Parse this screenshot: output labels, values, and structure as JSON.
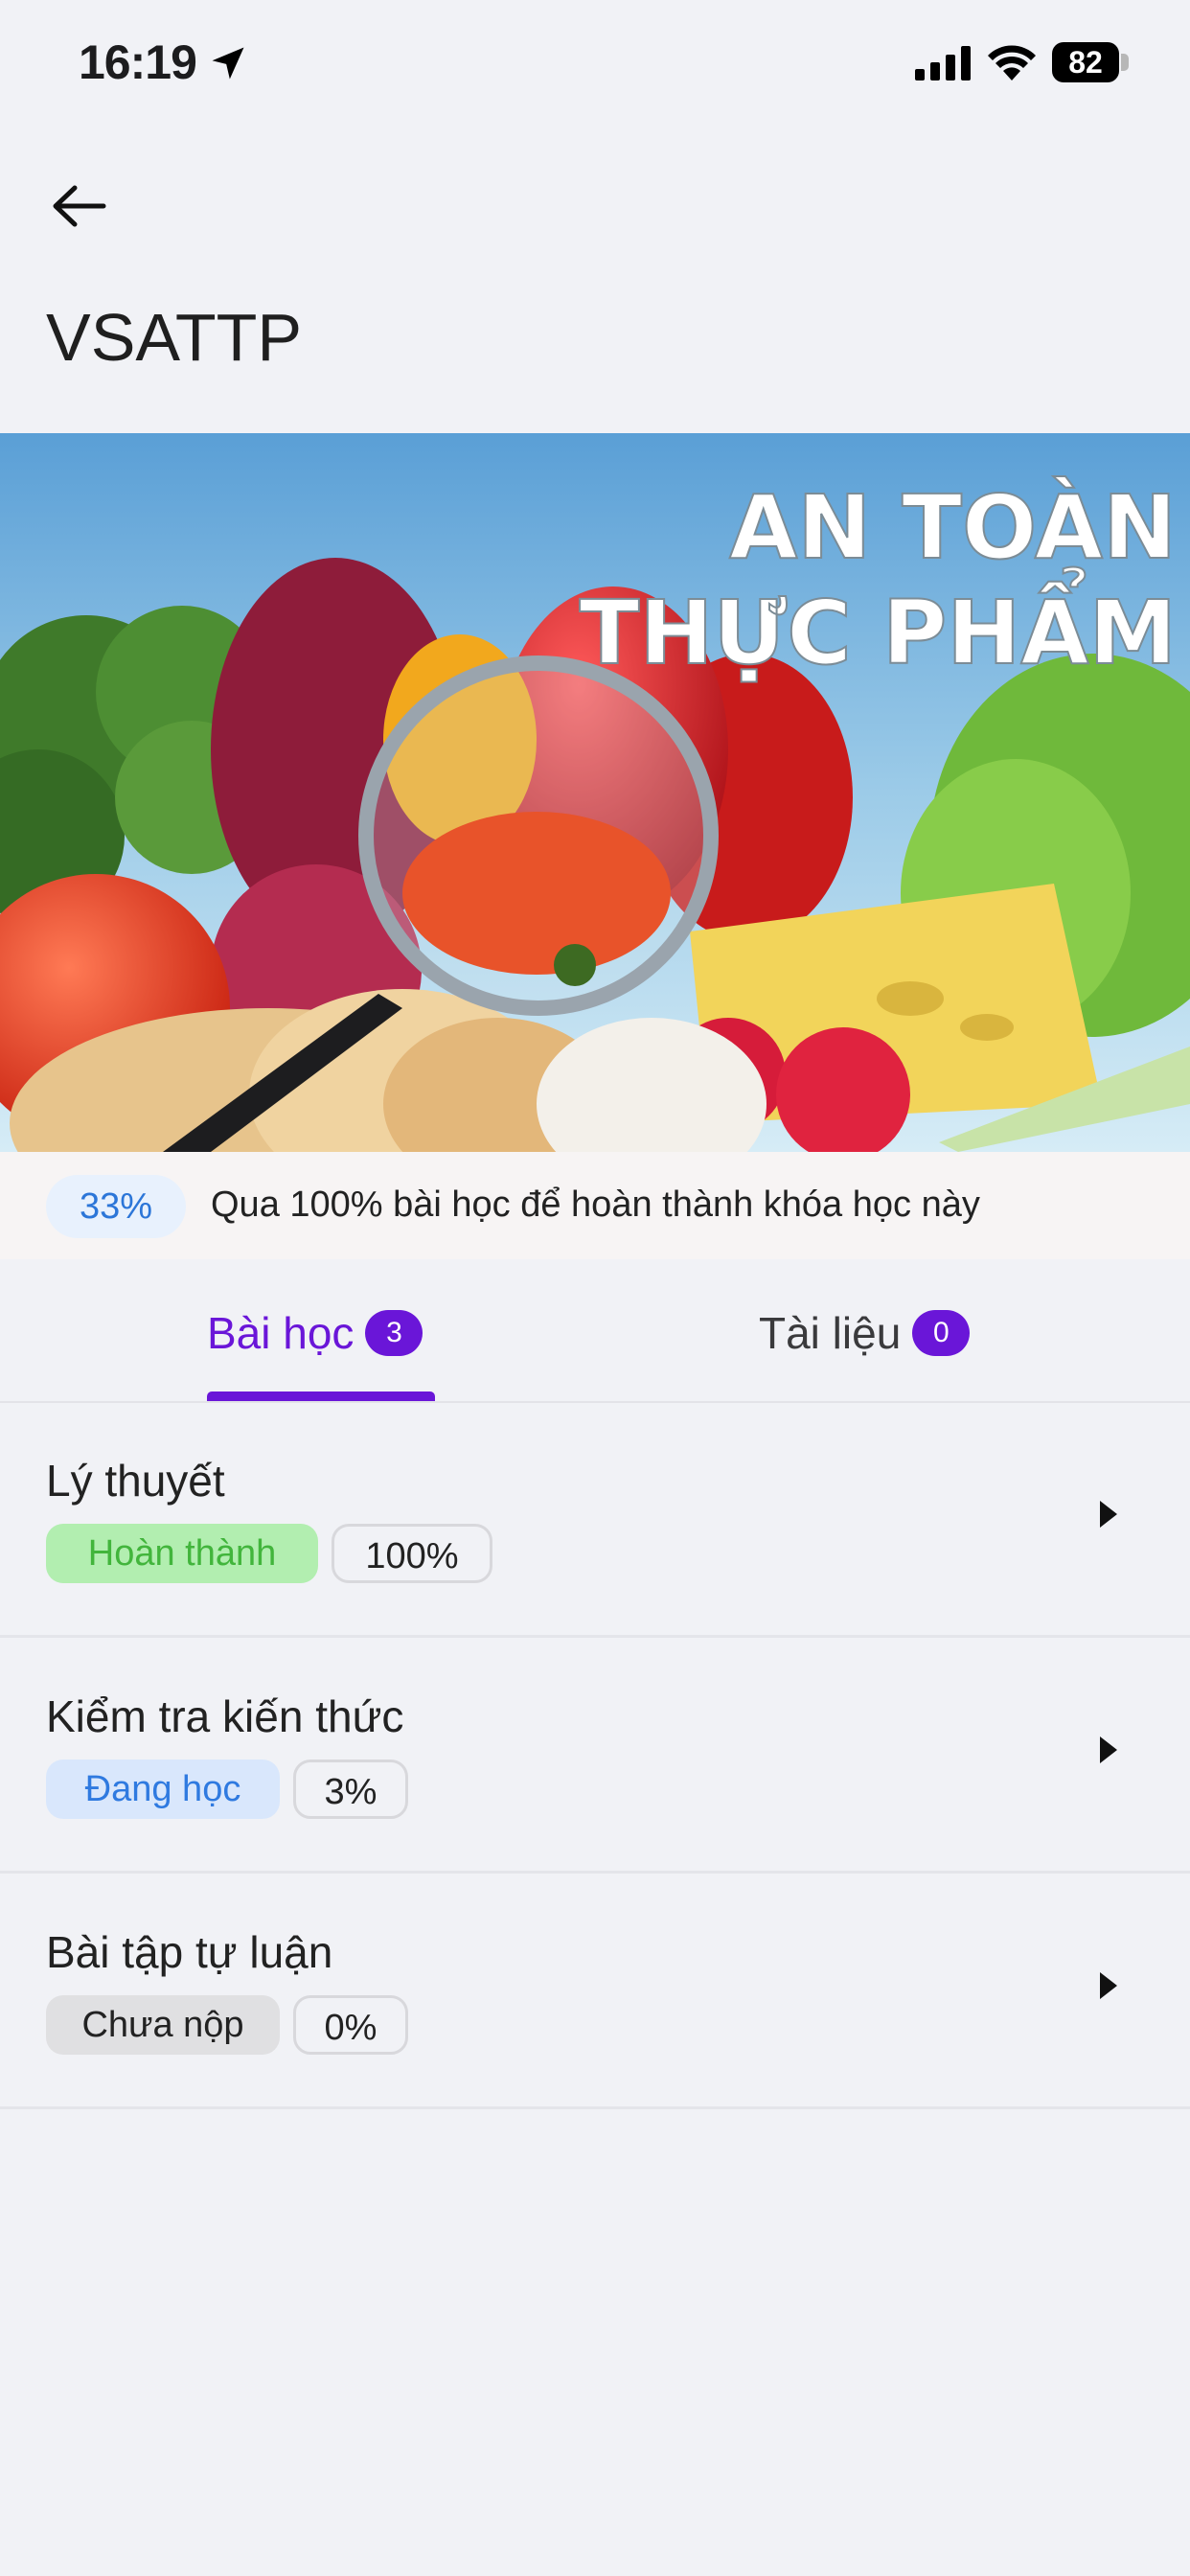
{
  "status_bar": {
    "time": "16:19",
    "battery": "82"
  },
  "header": {
    "title": "VSATTP"
  },
  "banner": {
    "line1": "AN TOÀN",
    "line2": "THỰC PHẨM"
  },
  "progress": {
    "percent_label": "33%",
    "percent": 33,
    "hint": "Qua 100% bài học để hoàn thành khóa học này"
  },
  "tabs": [
    {
      "label": "Bài học",
      "count": "3",
      "active": true
    },
    {
      "label": "Tài liệu",
      "count": "0",
      "active": false
    }
  ],
  "lessons": [
    {
      "title": "Lý thuyết",
      "status": "Hoàn thành",
      "percent": "100%"
    },
    {
      "title": "Kiểm tra kiến thức",
      "status": "Đang học",
      "percent": "3%"
    },
    {
      "title": "Bài tập tự luận",
      "status": "Chưa nộp",
      "percent": "0%"
    }
  ],
  "icons": {
    "back": "arrow-left-icon",
    "location": "location-arrow-icon",
    "signal": "cellular-signal-icon",
    "wifi": "wifi-icon",
    "battery": "battery-icon",
    "caret": "caret-right-icon"
  },
  "colors": {
    "accent": "#6a16d8",
    "done": "#42b53c",
    "learning": "#2f7ae0"
  }
}
